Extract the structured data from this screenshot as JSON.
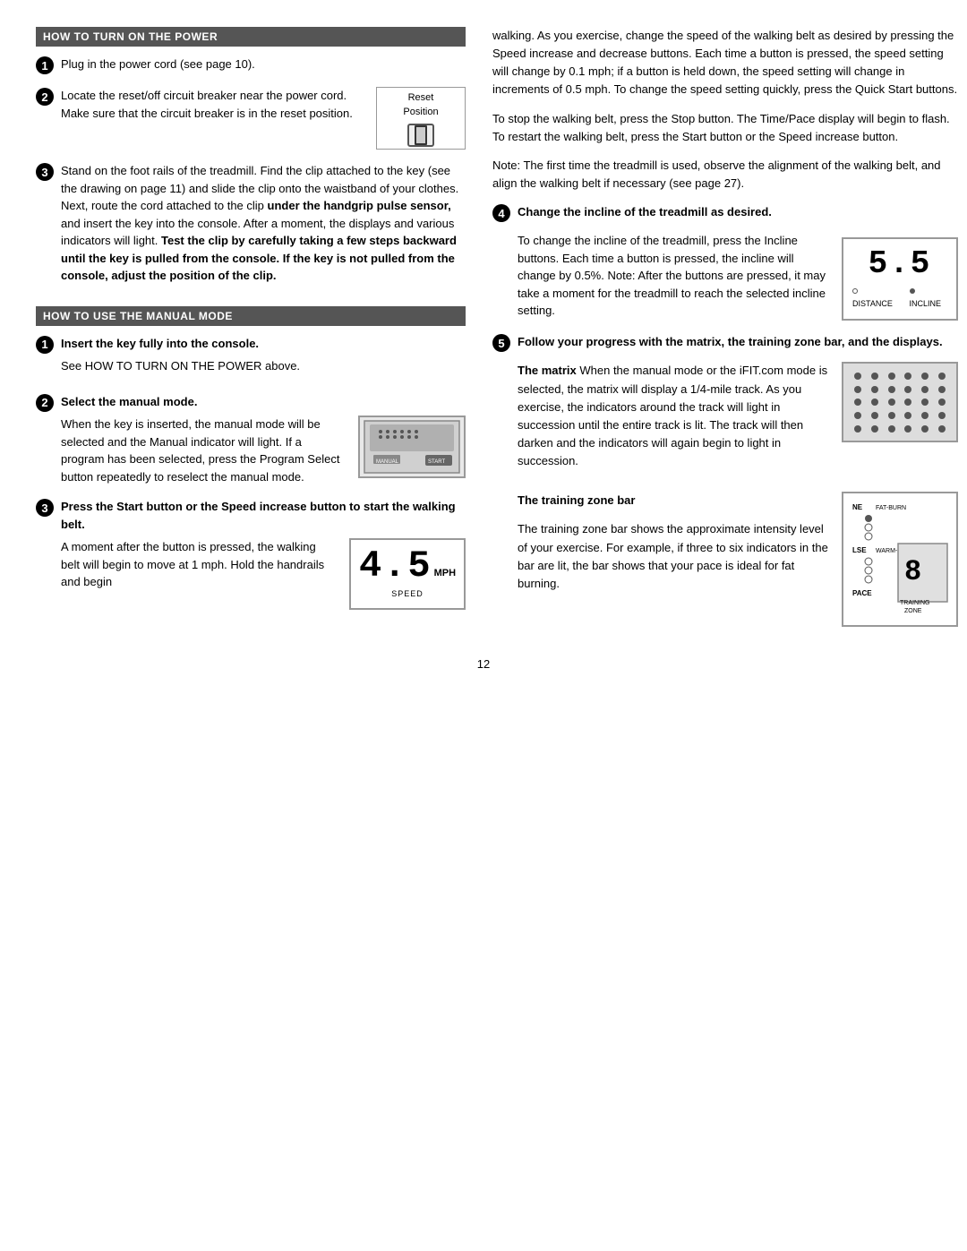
{
  "page": {
    "number": "12"
  },
  "left": {
    "section1": {
      "header": "HOW TO TURN ON THE POWER",
      "step1": {
        "number": "1",
        "text": "Plug in the power cord (see page 10)."
      },
      "step2": {
        "number": "2",
        "text1": "Locate the reset/off circuit breaker near the power cord. Make sure that the circuit breaker is in the reset position.",
        "reset_label": "Reset\nPosition"
      },
      "step3": {
        "number": "3",
        "text": "Stand on the foot rails of the treadmill. Find the clip attached to the key (see the drawing on page 11) and slide the clip onto the waistband of your clothes. Next, route the cord attached to the clip",
        "bold_part": "under the handgrip pulse sensor,",
        "text2": "and insert the key into the console. After a moment, the displays and various indicators will light.",
        "bold_part2": "Test the clip by carefully taking a few steps backward until the key is pulled from the console. If the key is not pulled from the console, adjust the position of the clip."
      }
    },
    "section2": {
      "header": "HOW TO USE THE MANUAL MODE",
      "step1": {
        "number": "1",
        "label": "Insert the key fully into the console.",
        "text": "See HOW TO TURN ON THE POWER above."
      },
      "step2": {
        "number": "2",
        "label": "Select the manual mode.",
        "text1": "When the key is inserted, the manual mode will be selected and the Manual indicator will light. If a program has been selected, press the Program Select button repeatedly to reselect the manual mode.",
        "manual_label": "MANUAL"
      },
      "step3": {
        "number": "3",
        "label": "Press the Start button or the Speed increase button to start the walking belt.",
        "text1": "A moment after the button is pressed, the walking belt will begin to move at 1 mph. Hold the handrails and begin",
        "speed_value": "4.5",
        "speed_unit": "MPH",
        "speed_label": "SPEED"
      }
    }
  },
  "right": {
    "para1": "walking. As you exercise, change the speed of the walking belt as desired by pressing the Speed increase and decrease buttons. Each time a button is pressed, the speed setting will change by 0.1 mph; if a button is held down, the speed setting will change in increments of 0.5 mph. To change the speed setting quickly, press the Quick Start buttons.",
    "para2": "To stop the walking belt, press the Stop button. The Time/Pace display will begin to flash. To restart the walking belt, press the Start button or the Speed increase button.",
    "para3": "Note: The first time the treadmill is used, observe the alignment of the walking belt, and align the walking belt if necessary (see page 27).",
    "step4": {
      "number": "4",
      "label": "Change the incline of the treadmill as desired.",
      "text": "To change the incline of the treadmill, press the Incline buttons. Each time a button is pressed, the incline will change by 0.5%. Note: After the buttons are pressed, it may take a moment for the treadmill to reach the selected incline setting.",
      "incline_value": "5.5",
      "distance_label": "DISTANCE",
      "incline_label": "INCLINE"
    },
    "step5": {
      "number": "5",
      "label": "Follow your progress with the matrix, the training zone bar, and the displays.",
      "matrix_text1": "The matrix",
      "matrix_text2": "When the manual mode or the iFIT.com mode is selected, the matrix will display a 1/4-mile track. As you exercise, the indicators around the track will light in succession until the entire track is lit. The track will then darken and the indicators will again begin to light in succession.",
      "training_zone_label": "The training zone bar",
      "training_zone_text": "The training zone bar shows the approximate intensity level of your exercise. For example, if three to six indicators in the bar are lit, the bar shows that your pace is ideal for fat burning.",
      "tz_labels": {
        "ne": "NE",
        "lse": "LSE",
        "pace": "PACE",
        "fat_burn": "FAT-BURN",
        "warm_up": "WARM-UP",
        "training_zone": "TRAINING ZONE"
      }
    }
  }
}
